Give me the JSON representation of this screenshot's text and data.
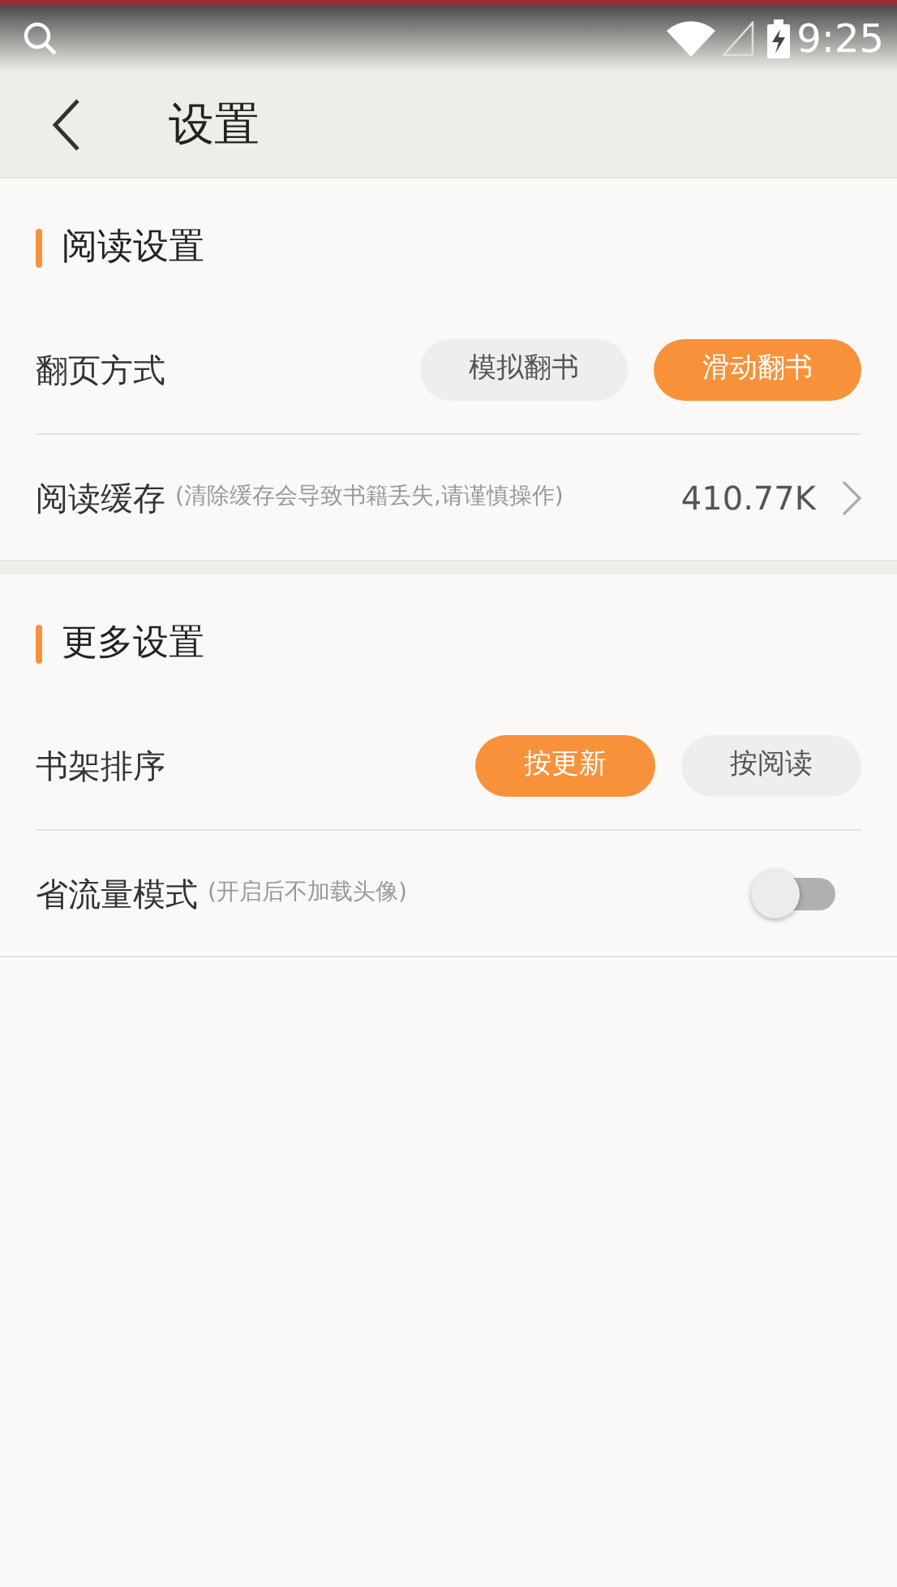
{
  "status_bar": {
    "time": "9:25"
  },
  "header": {
    "title": "设置"
  },
  "sections": [
    {
      "title": "阅读设置",
      "rows": [
        {
          "kind": "choice",
          "label": "翻页方式",
          "options": [
            {
              "label": "模拟翻书",
              "selected": false
            },
            {
              "label": "滑动翻书",
              "selected": true
            }
          ]
        },
        {
          "kind": "value",
          "label": "阅读缓存",
          "note": "(清除缓存会导致书籍丢失,请谨慎操作)",
          "value": "410.77K"
        }
      ]
    },
    {
      "title": "更多设置",
      "rows": [
        {
          "kind": "choice",
          "label": "书架排序",
          "options": [
            {
              "label": "按更新",
              "selected": true
            },
            {
              "label": "按阅读",
              "selected": false
            }
          ]
        },
        {
          "kind": "toggle",
          "label": "省流量模式",
          "note": "(开启后不加载头像)",
          "on": false
        }
      ]
    }
  ]
}
